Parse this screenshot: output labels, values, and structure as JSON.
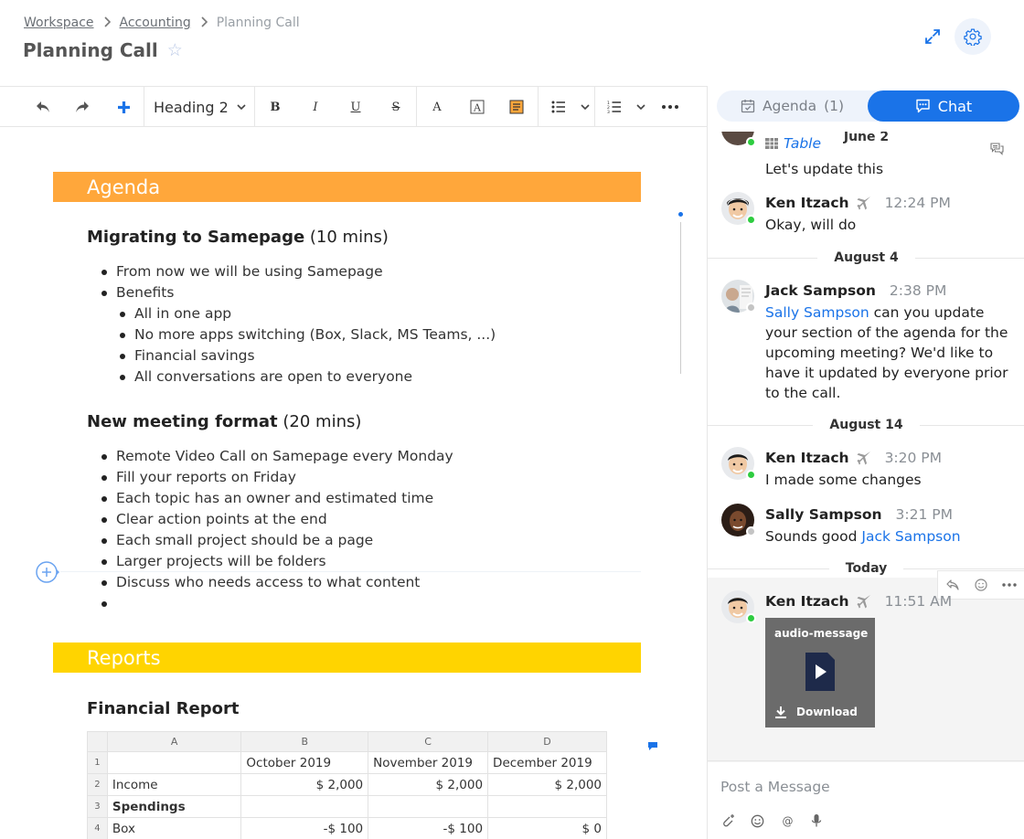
{
  "breadcrumb": {
    "items": [
      "Workspace",
      "Accounting"
    ],
    "current": "Planning Call"
  },
  "page": {
    "title": "Planning Call"
  },
  "toolbar": {
    "heading_style": "Heading 2"
  },
  "doc": {
    "agenda_title": "Agenda",
    "topic1": {
      "title": "Migrating to Samepage",
      "duration": "(10 mins)",
      "items": [
        "From now we will be using Samepage",
        "Benefits"
      ],
      "subitems": [
        "All in one app",
        "No more apps switching (Box, Slack, MS Teams, ...)",
        "Financial savings",
        "All conversations are open to everyone"
      ]
    },
    "topic2": {
      "title": "New meeting format",
      "duration": "(20 mins)",
      "items": [
        "Remote Video Call on Samepage every Monday",
        "Fill your reports on Friday",
        "Each topic has an owner and estimated time",
        "Clear action points at the end",
        "Each small project should be a page",
        "Larger projects will be folders",
        "Discuss who needs access to what content",
        ""
      ]
    },
    "reports_title": "Reports",
    "financial_title": "Financial Report",
    "sheet": {
      "columns": [
        "A",
        "B",
        "C",
        "D"
      ],
      "rows": [
        {
          "n": "1",
          "cells": [
            "",
            "October 2019",
            "November 2019",
            "December 2019"
          ]
        },
        {
          "n": "2",
          "cells": [
            "Income",
            "$ 2,000",
            "$ 2,000",
            "$ 2,000"
          ]
        },
        {
          "n": "3",
          "cells": [
            "Spendings",
            "",
            "",
            ""
          ]
        },
        {
          "n": "4",
          "cells": [
            "Box",
            "-$ 100",
            "-$ 100",
            "$ 0"
          ]
        }
      ]
    }
  },
  "chat": {
    "tab_agenda": "Agenda",
    "tab_agenda_count": "(1)",
    "tab_chat": "Chat",
    "first": {
      "date": "June 2",
      "table_label": "Table",
      "text": "Let's update this"
    },
    "msg_ken1": {
      "name": "Ken Itzach",
      "time": "12:24 PM",
      "text": "Okay, will do"
    },
    "date_aug4": "August 4",
    "msg_jack": {
      "name": "Jack Sampson",
      "time": "2:38 PM",
      "mention": "Sally Sampson",
      "text": "can you update your section of the agenda for the upcoming meeting? We'd like to have it updated by everyone prior to the call."
    },
    "date_aug14": "August 14",
    "msg_ken2": {
      "name": "Ken Itzach",
      "time": "3:20 PM",
      "text": "I made some changes"
    },
    "msg_sally": {
      "name": "Sally Sampson",
      "time": "3:21 PM",
      "text": "Sounds good",
      "mention": "Jack Sampson"
    },
    "date_today": "Today",
    "msg_ken3": {
      "name": "Ken Itzach",
      "time": "11:51 AM",
      "file_name": "audio-message...",
      "download": "Download"
    },
    "composer_placeholder": "Post a Message"
  },
  "colors": {
    "accent": "#1a73e8",
    "agenda_bar": "#ffa73b",
    "reports_bar": "#ffd400",
    "online": "#2ecc40",
    "offline": "#c4c4c4"
  }
}
